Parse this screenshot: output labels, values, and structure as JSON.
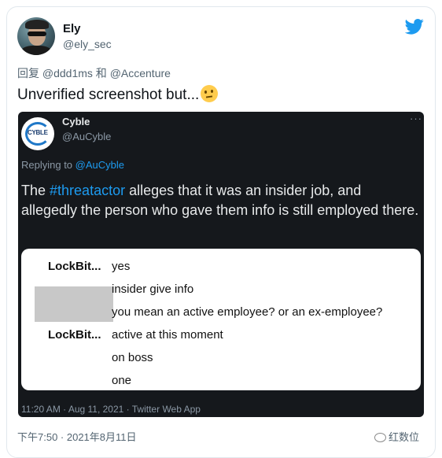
{
  "author": {
    "name": "Ely",
    "handle": "@ely_sec"
  },
  "reply": {
    "prefix": "回复",
    "mentions": "@ddd1ms 和 @Accenture"
  },
  "tweet": {
    "text": "Unverified screenshot but...",
    "emoji": "thinking-face"
  },
  "embedded": {
    "logo_text": "CYBLE",
    "name": "Cyble",
    "handle": "@AuCyble",
    "more": "···",
    "replying_prefix": "Replying to",
    "replying_mention": "@AuCyble",
    "text_before": "The ",
    "hashtag": "#threatactor",
    "text_after": " alleges that it was an insider job, and allegedly the person who gave them info is still employed there.",
    "chat": [
      {
        "sender": "LockBit...",
        "message": "yes"
      },
      {
        "sender": "",
        "message": "insider give info"
      },
      {
        "sender": "",
        "message": "you mean an active employee? or an ex-employee?"
      },
      {
        "sender": "LockBit...",
        "message": "active at this moment"
      },
      {
        "sender": "",
        "message": "on boss"
      },
      {
        "sender": "",
        "message": "one"
      }
    ],
    "footer": "11:20 AM · Aug 11, 2021 · Twitter Web App"
  },
  "timestamp": "下午7:50 · 2021年8月11日",
  "watermark": "红数位",
  "colors": {
    "accent": "#1d9bf0",
    "dark_bg": "#15181c"
  }
}
